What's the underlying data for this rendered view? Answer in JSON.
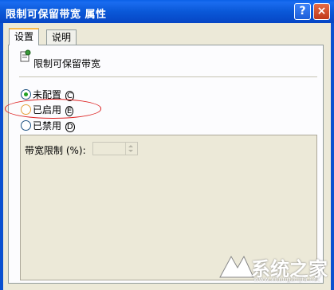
{
  "window": {
    "title": "限制可保留带宽 属性",
    "help_label": "?",
    "close_label": "×"
  },
  "tabs": [
    {
      "label": "设置"
    },
    {
      "label": "说明"
    }
  ],
  "policy": {
    "name": "限制可保留带宽",
    "icon": "policy-setting-icon"
  },
  "options": [
    {
      "label": "未配置",
      "hotkey": "C",
      "checked": true
    },
    {
      "label": "已启用",
      "hotkey": "E",
      "checked": false
    },
    {
      "label": "已禁用",
      "hotkey": "D",
      "checked": false
    }
  ],
  "bandwidth": {
    "label": "带宽限制 (%):",
    "value": ""
  },
  "watermark": {
    "text": "系统之家",
    "url": "www.xitongzhijia.net"
  }
}
